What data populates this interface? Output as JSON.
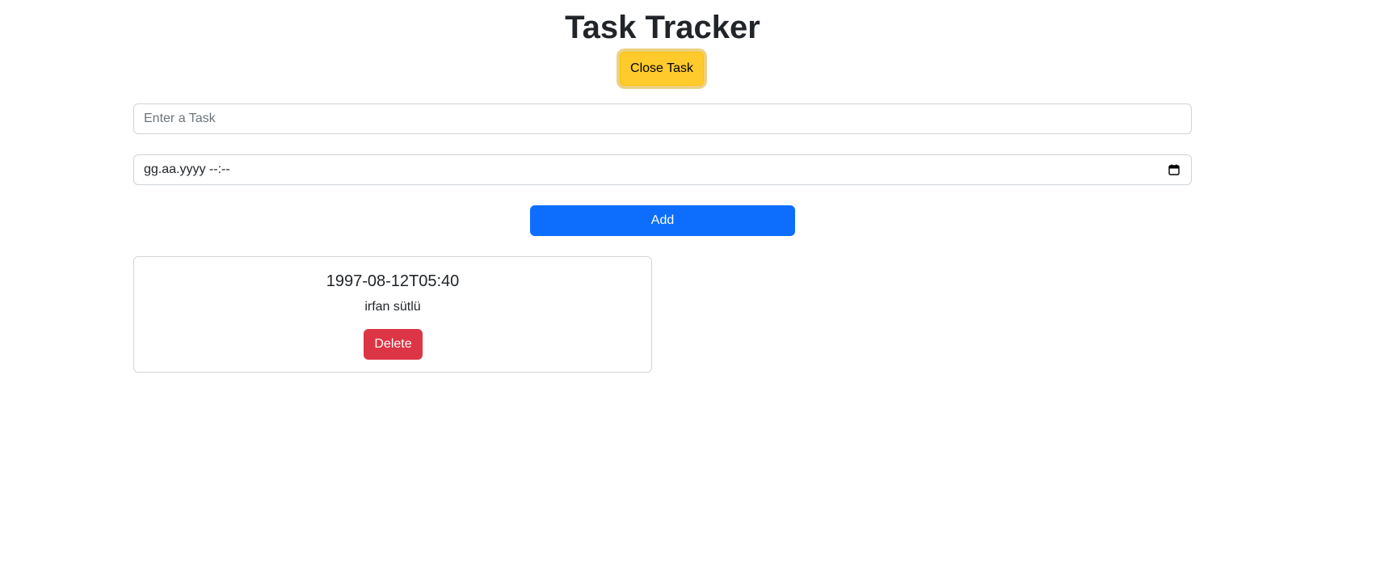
{
  "header": {
    "title": "Task Tracker",
    "toggle_button_label": "Close Task"
  },
  "form": {
    "task_input": {
      "placeholder": "Enter a Task",
      "value": ""
    },
    "datetime_input": {
      "display_value": "gg.aa.yyyy --:--",
      "icon": "calendar-icon"
    },
    "add_button_label": "Add"
  },
  "tasks": [
    {
      "date": "1997-08-12T05:40",
      "text": "irfan sütlü",
      "delete_label": "Delete"
    }
  ],
  "colors": {
    "toggle_button": "#ffca2c",
    "add_button": "#0d6efd",
    "delete_button": "#dc3545"
  }
}
